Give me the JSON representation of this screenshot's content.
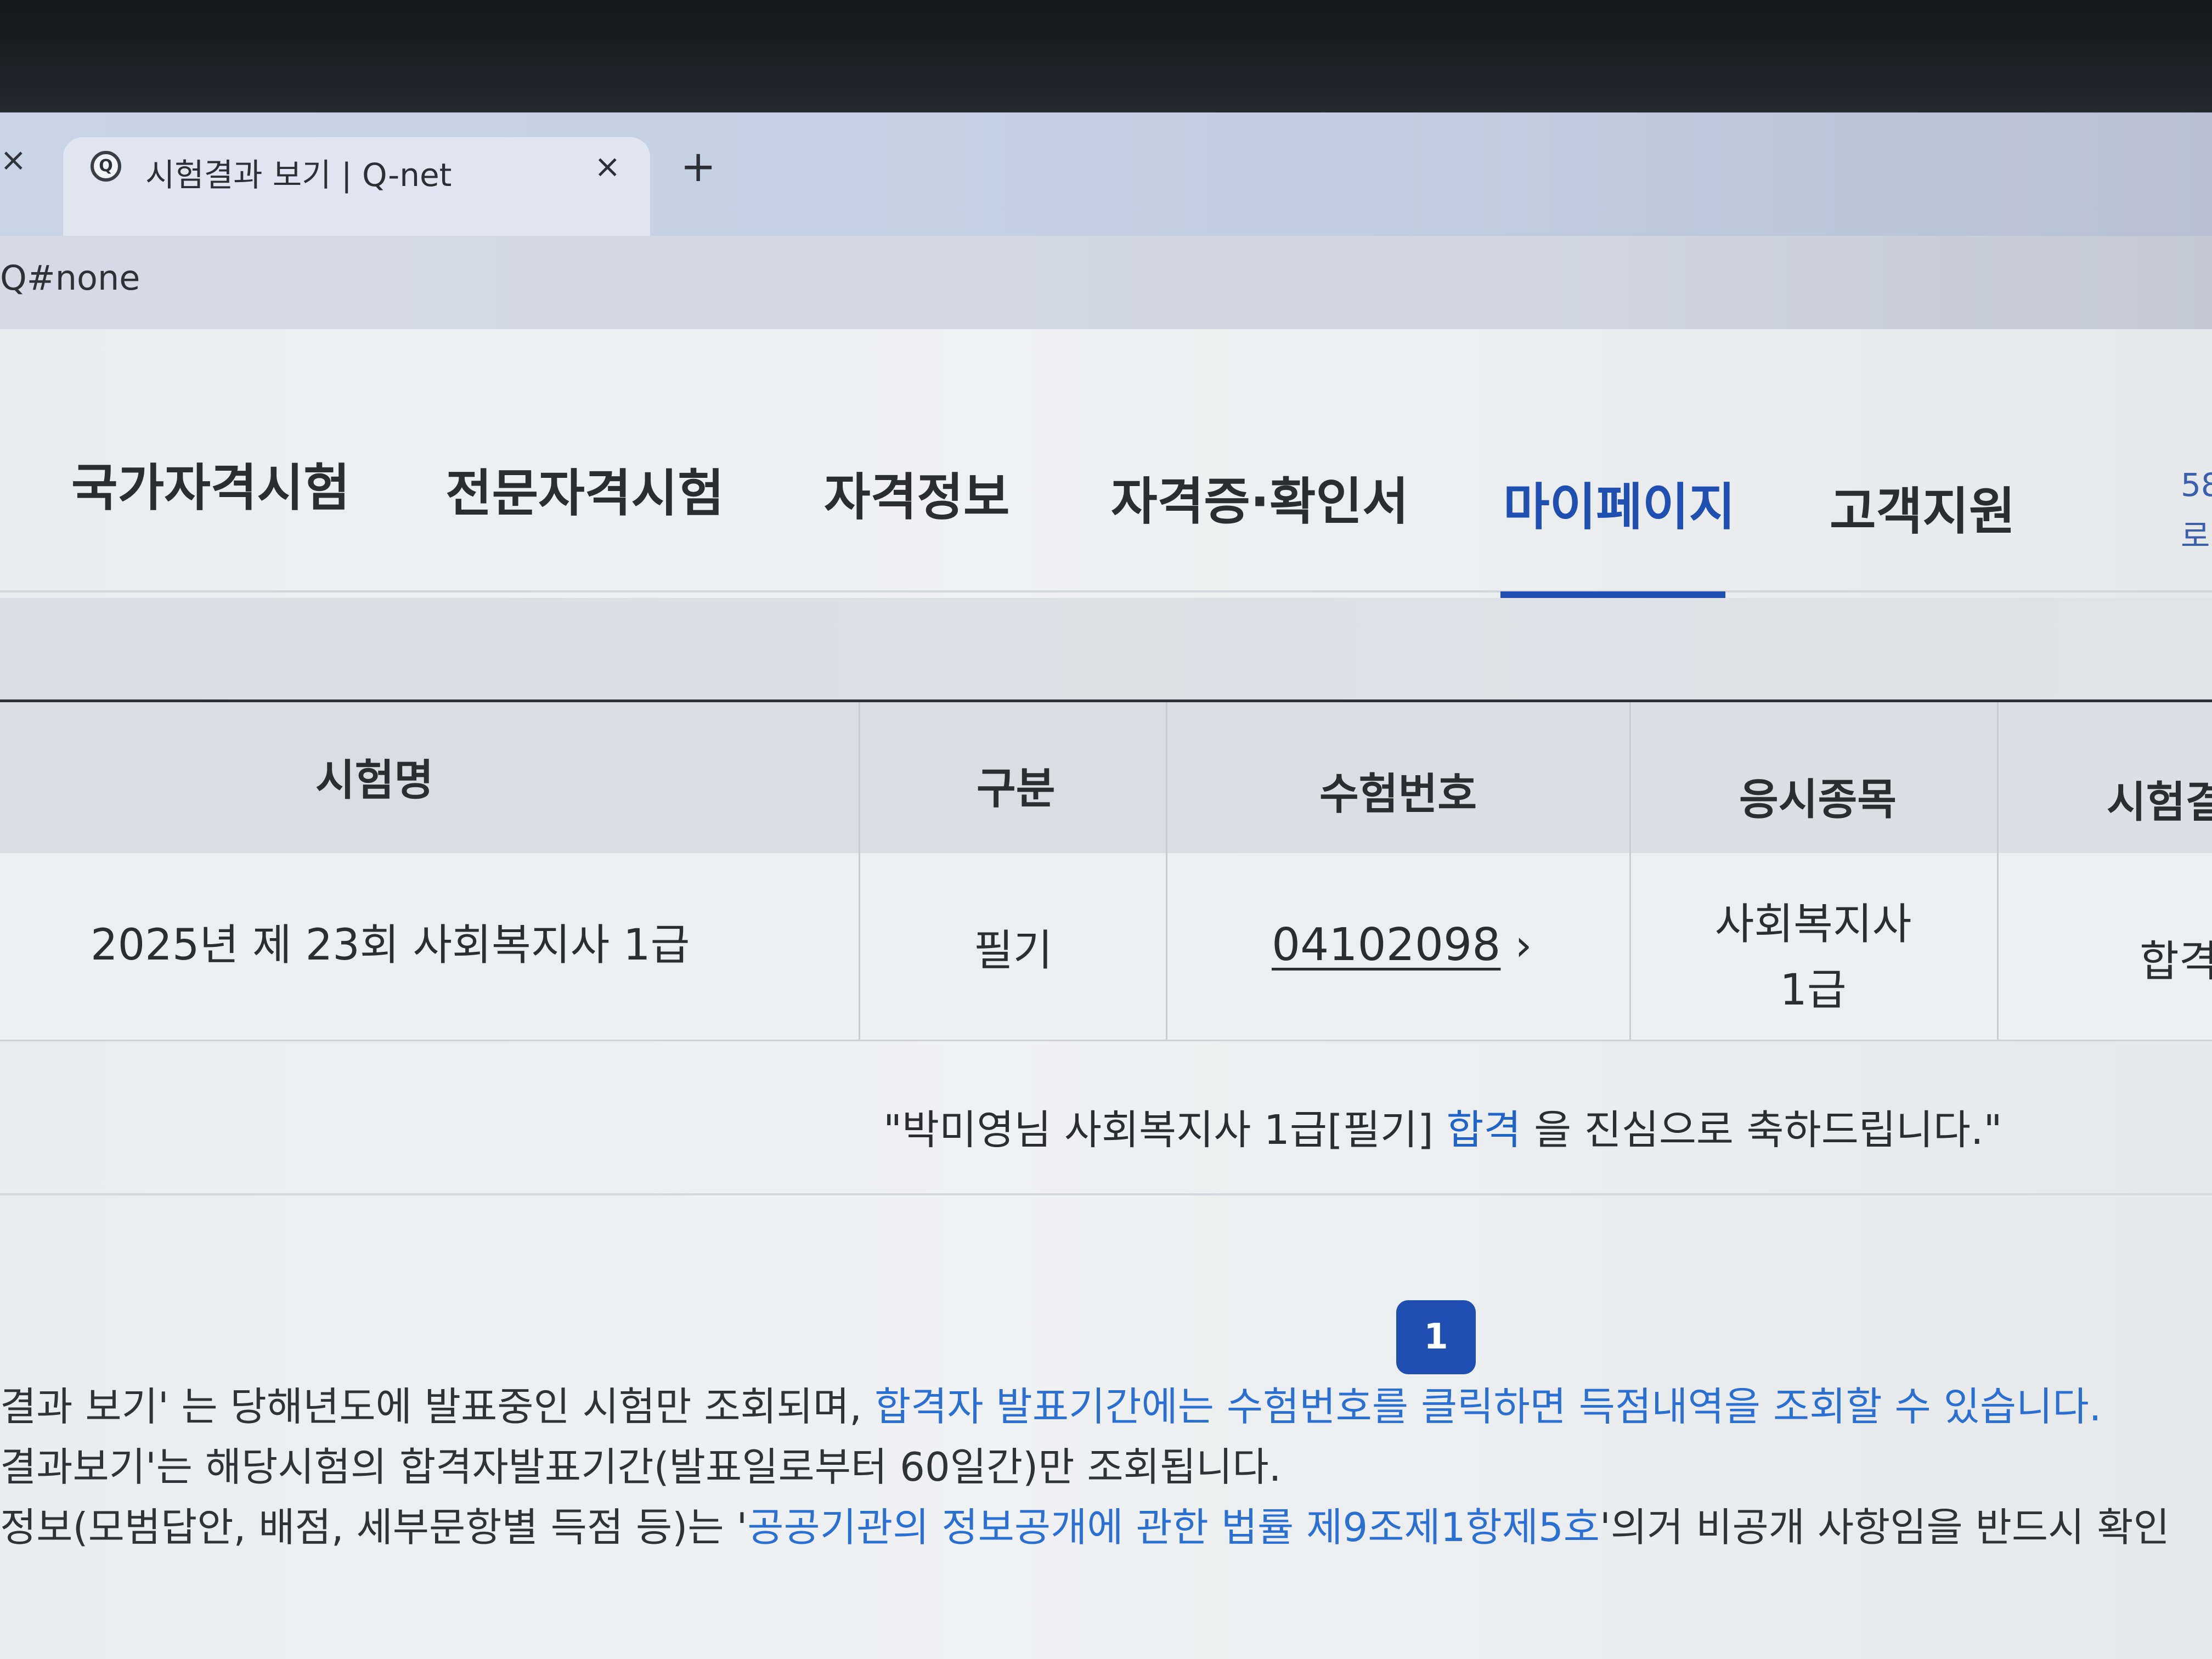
{
  "browser": {
    "prev_tab_close": "×",
    "tab": {
      "favicon": "Q",
      "title": "시험결과 보기 | Q-net",
      "close": "×"
    },
    "new_tab": "+",
    "url": "Q#none"
  },
  "nav": {
    "items": [
      {
        "label": "국가자격시험"
      },
      {
        "label": "전문자격시험"
      },
      {
        "label": "자격정보"
      },
      {
        "label": "자격증·확인서"
      },
      {
        "label": "마이페이지",
        "active": true
      },
      {
        "label": "고객지원"
      }
    ],
    "edge_top": "58",
    "edge_bottom": "로"
  },
  "table": {
    "headers": [
      "시험명",
      "구분",
      "수험번호",
      "응시종목",
      "시험결"
    ],
    "row": {
      "exam_name": "2025년 제 23회 사회복지사 1급",
      "category": "필기",
      "exam_number": "04102098",
      "subject": "사회복지사 1급",
      "result": "합격"
    }
  },
  "congrats": {
    "prefix": "\"박미영님 사회복지사 1급[필기] ",
    "highlight": "합격",
    "suffix": " 을 진심으로 축하드립니다.\""
  },
  "pagination": {
    "current": "1"
  },
  "notes": [
    {
      "text": "결과 보기' 는 당해년도에 발표중인 시험만 조회되며, ",
      "link": "합격자 발표기간에는 수험번호를 클릭하면 득점내역을 조회할 수 있습니다.",
      "tail": ""
    },
    {
      "text": "결과보기'는 해당시험의 합격자발표기간(발표일로부터 60일간)만 조회됩니다.",
      "link": "",
      "tail": ""
    },
    {
      "text": "정보(모범답안, 배점, 세부문항별 득점 등)는 '",
      "link": "공공기관의 정보공개에 관한 법률 제9조제1항제5호",
      "tail": "'의거 비공개 사항임을 반드시 확인"
    }
  ],
  "colors": {
    "accent": "#1f4fb0",
    "link": "#2a6fd2"
  }
}
